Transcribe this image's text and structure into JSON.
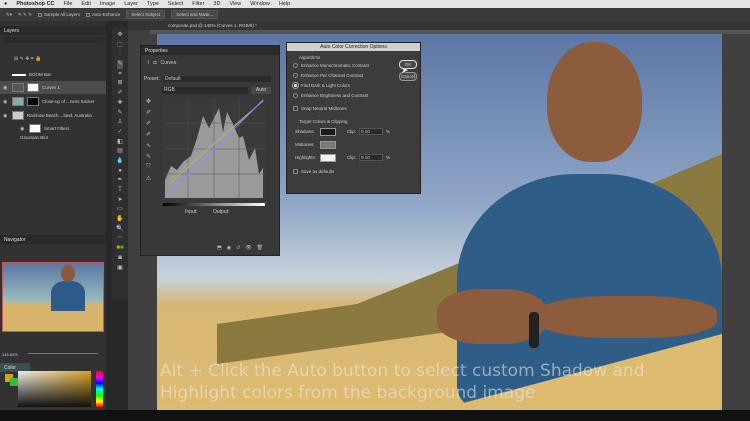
{
  "menubar": {
    "app": "Photoshop CC",
    "items": [
      "File",
      "Edit",
      "Image",
      "Layer",
      "Type",
      "Select",
      "Filter",
      "3D",
      "View",
      "Window",
      "Help"
    ]
  },
  "options": {
    "sample_all": "Sample All Layers",
    "auto_enhance": "Auto-Enhance",
    "select_subject": "Select Subject",
    "select_mask": "Select and Mask..."
  },
  "document": {
    "tab": "composite.psd @ 145% (Curves 1, RGB/8) *"
  },
  "layers": {
    "title": "Layers",
    "items": [
      {
        "name": "BOOM Bar"
      },
      {
        "name": "Curves 1"
      },
      {
        "name": "Close-up of ...ness tracker"
      },
      {
        "name": "Rainbow Beach ...land, Australia"
      },
      {
        "name": "Smart Filters"
      },
      {
        "name": "Gaussian Blur"
      }
    ]
  },
  "navigator": {
    "title": "Navigator",
    "zoom": "145.83%"
  },
  "color": {
    "title": "Color"
  },
  "properties": {
    "title": "Properties",
    "type": "Curves",
    "preset_label": "Preset:",
    "preset": "Default",
    "channel": "RGB",
    "auto": "Auto",
    "input": "Input:",
    "output": "Output:"
  },
  "dialog": {
    "title": "Auto Color Correction Options",
    "algorithms": "Algorithms",
    "options": [
      "Enhance Monochromatic Contrast",
      "Enhance Per Channel Contrast",
      "Find Dark & Light Colors",
      "Enhance Brightness and Contrast"
    ],
    "selected": 2,
    "snap": "Snap Neutral Midtones",
    "target": "Target Colors & Clipping",
    "shadows": "Shadows:",
    "midtones": "Midtones:",
    "highlights": "Highlights:",
    "clip": "Clip:",
    "shadow_clip": "0.10",
    "highlight_clip": "0.10",
    "percent": "%",
    "save": "Save as defaults",
    "ok": "OK",
    "cancel": "Cancel",
    "colors": {
      "shadow": "#1c1a12",
      "midtone": "#7a7a7a",
      "highlight": "#f6f2e4"
    }
  },
  "caption": {
    "line1": "Alt + Click the Auto button to select custom Shadow and",
    "line2": "Highlight colors from the background image"
  }
}
